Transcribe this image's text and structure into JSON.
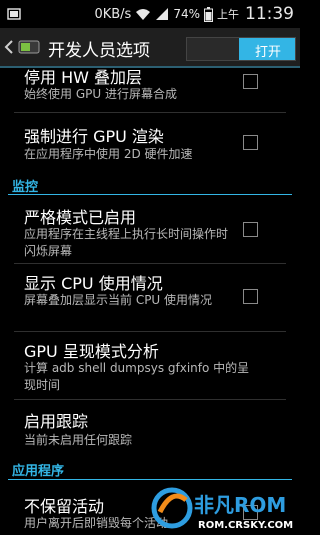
{
  "status_bar": {
    "network_speed": "0KB/s",
    "battery_percent": "74%",
    "ampm": "上午",
    "time": "11:39",
    "icons": [
      "notification-icon",
      "wifi-icon",
      "signal-icon",
      "battery-icon"
    ]
  },
  "action_bar": {
    "title": "开发人员选项",
    "toggle_label": "打开",
    "toggle_on": true,
    "accent_color": "#33b5e5"
  },
  "items": [
    {
      "title": "停用 HW 叠加层",
      "subtitle": "始终使用 GPU 进行屏幕合成",
      "checked": false
    },
    {
      "title": "强制进行 GPU 渲染",
      "subtitle": "在应用程序中使用 2D 硬件加速",
      "checked": false
    }
  ],
  "section_monitoring": {
    "header": "监控",
    "items": [
      {
        "title": "严格模式已启用",
        "subtitle": "应用程序在主线程上执行长时间操作时闪烁屏幕",
        "checked": false
      },
      {
        "title": "显示 CPU 使用情况",
        "subtitle": "屏幕叠加层显示当前 CPU 使用情况",
        "checked": false
      },
      {
        "title": "GPU 呈现模式分析",
        "subtitle": "计算 adb shell dumpsys gfxinfo 中的呈现时间",
        "checked": false
      },
      {
        "title": "启用跟踪",
        "subtitle": "当前未启用任何跟踪"
      }
    ]
  },
  "section_apps": {
    "header": "应用程序",
    "items": [
      {
        "title": "不保留活动",
        "subtitle": "用户离开后即销毁每个活动",
        "checked": false
      }
    ]
  },
  "watermark": {
    "brand": "非凡ROM",
    "url": "ROM.CRSKY.COM"
  }
}
